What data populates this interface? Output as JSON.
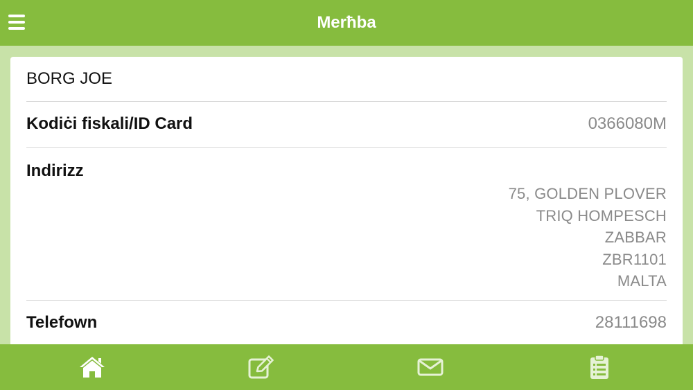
{
  "header": {
    "title": "Merħba"
  },
  "profile": {
    "name": "BORG JOE",
    "id_label": "Kodiċi fiskali/ID Card",
    "id_value": "0366080M",
    "address_label": "Indirizz",
    "address_lines": [
      "75, GOLDEN PLOVER",
      "TRIQ HOMPESCH",
      "ZABBAR",
      "ZBR1101",
      "MALTA"
    ],
    "phone_label": "Telefown",
    "phone_value": "28111698"
  },
  "bottom_nav": {
    "items": [
      "home-icon",
      "edit-icon",
      "mail-icon",
      "clipboard-icon"
    ]
  },
  "colors": {
    "bar": "#86bc3e",
    "background": "#c8e2a8",
    "card": "#ffffff",
    "value_text": "#8a8a8a"
  }
}
